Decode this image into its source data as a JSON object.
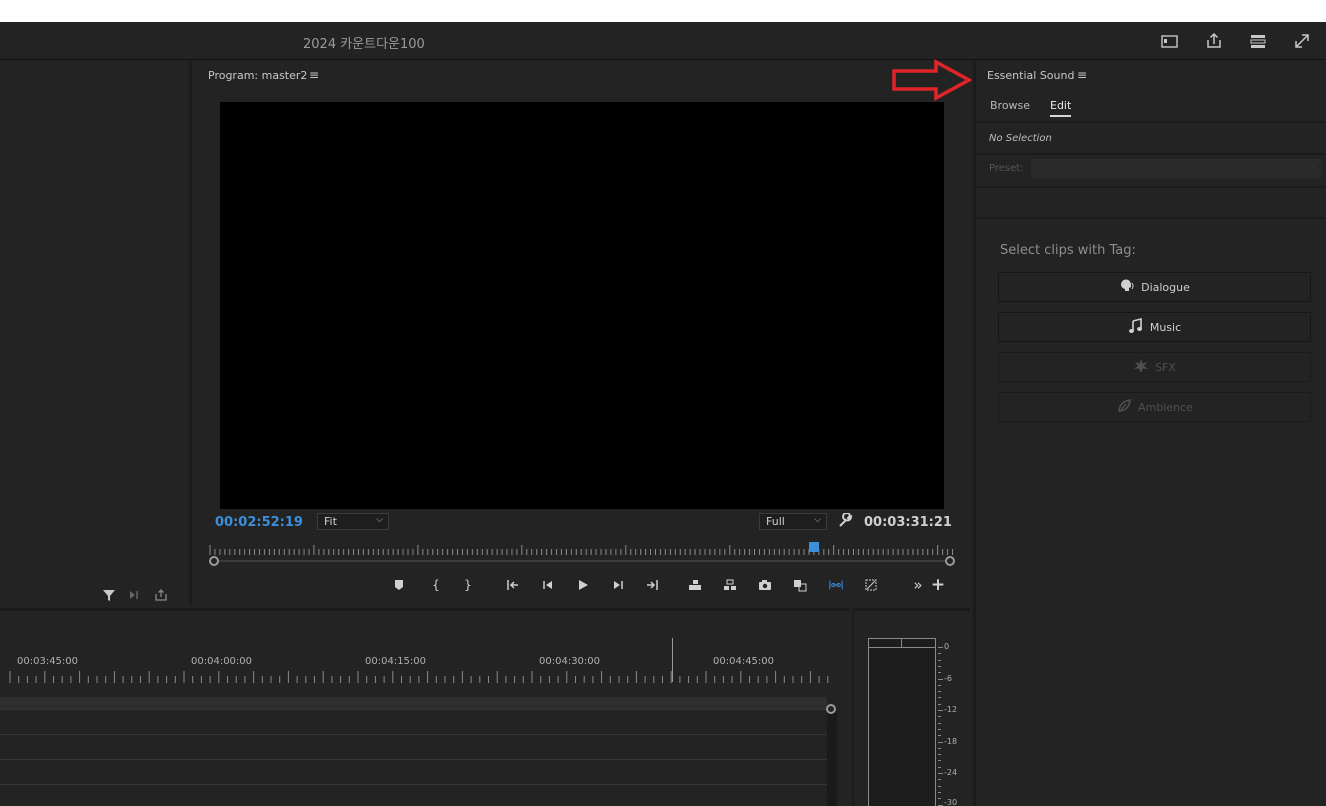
{
  "app": {
    "title": "2024 카운트다운100"
  },
  "program": {
    "title": "Program: master2",
    "timecode_current": "00:02:52:19",
    "timecode_duration": "00:03:31:21",
    "zoom": "Fit",
    "resolution": "Full"
  },
  "essential_sound": {
    "title": "Essential Sound",
    "tabs": [
      {
        "label": "Browse",
        "active": false
      },
      {
        "label": "Edit",
        "active": true
      }
    ],
    "selection_state": "No Selection",
    "preset_label": "Preset:",
    "tag_heading": "Select clips with Tag:",
    "tags": [
      {
        "label": "Dialogue",
        "icon": "dialogue-icon",
        "enabled": true
      },
      {
        "label": "Music",
        "icon": "music-note-icon",
        "enabled": true
      },
      {
        "label": "SFX",
        "icon": "sfx-burst-icon",
        "enabled": false
      },
      {
        "label": "Ambience",
        "icon": "ambience-leaf-icon",
        "enabled": false
      }
    ]
  },
  "timeline": {
    "ruler_labels": [
      "00:03:45:00",
      "00:04:00:00",
      "00:04:15:00",
      "00:04:30:00",
      "00:04:45:00"
    ]
  },
  "audio_meter": {
    "scale": [
      "0",
      "-6",
      "-12",
      "-18",
      "-24",
      "-30"
    ]
  },
  "colors": {
    "accent_blue": "#3b8fdb",
    "annotation_red": "#e0242a",
    "panel_bg": "#232323"
  }
}
